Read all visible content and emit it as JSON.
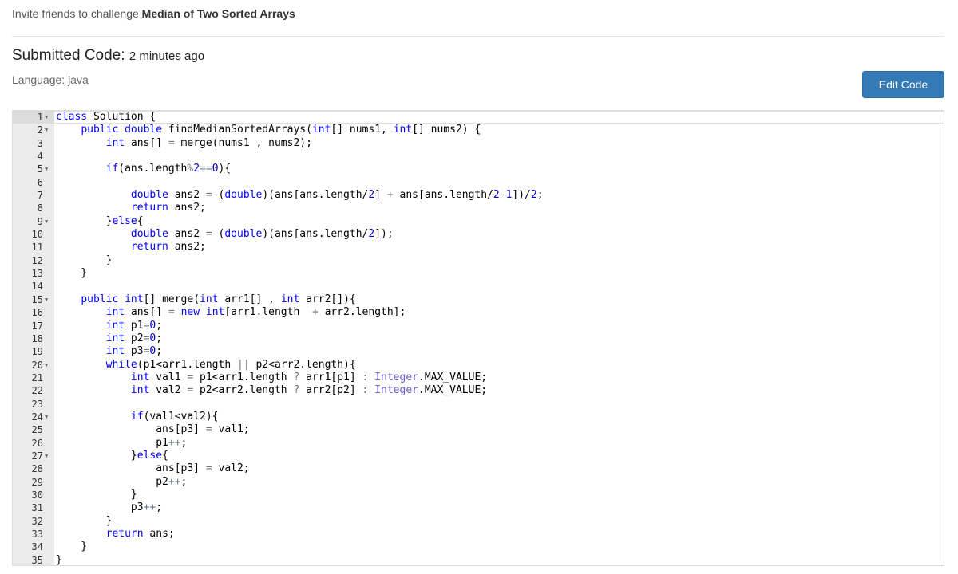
{
  "header": {
    "invite_prefix": "Invite friends to challenge",
    "problem_name": "Median of Two Sorted Arrays"
  },
  "submission": {
    "title": "Submitted Code:",
    "time": "2 minutes ago",
    "language": "Language: java",
    "edit_label": "Edit Code"
  },
  "code": {
    "language": "java",
    "lines": [
      "class Solution {",
      "    public double findMedianSortedArrays(int[] nums1, int[] nums2) {",
      "        int ans[] = merge(nums1 , nums2);",
      "",
      "        if(ans.length%2==0){",
      "",
      "            double ans2 = (double)(ans[ans.length/2] + ans[ans.length/2-1])/2;",
      "            return ans2;",
      "        }else{",
      "            double ans2 = (double)(ans[ans.length/2]);",
      "            return ans2;",
      "        }",
      "    }",
      "",
      "    public int[] merge(int arr1[] , int arr2[]){",
      "        int ans[] = new int[arr1.length  + arr2.length];",
      "        int p1=0;",
      "        int p2=0;",
      "        int p3=0;",
      "        while(p1<arr1.length || p2<arr2.length){",
      "            int val1 = p1<arr1.length ? arr1[p1] : Integer.MAX_VALUE;",
      "            int val2 = p2<arr2.length ? arr2[p2] : Integer.MAX_VALUE;",
      "",
      "            if(val1<val2){",
      "                ans[p3] = val1;",
      "                p1++;",
      "            }else{",
      "                ans[p3] = val2;",
      "                p2++;",
      "            }",
      "            p3++;",
      "        }",
      "        return ans;",
      "    }",
      "}"
    ],
    "foldable_lines": [
      1,
      2,
      5,
      9,
      15,
      20,
      24,
      27
    ],
    "active_line": 1
  }
}
